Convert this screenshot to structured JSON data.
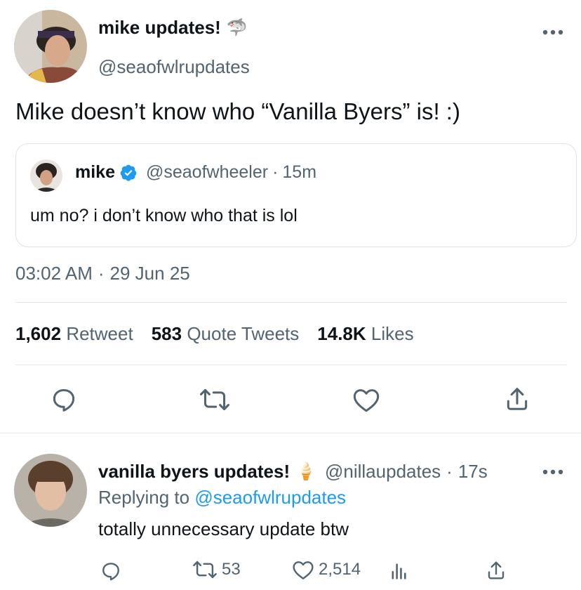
{
  "main_tweet": {
    "author_name": "mike updates!",
    "author_emoji": "🦈",
    "author_handle": "@seaofwlrupdates",
    "text": "Mike doesn’t know who “Vanilla Byers” is! :)",
    "more_icon": "more-horizontal-icon",
    "quoted": {
      "author_name": "mike",
      "verified_icon": "verified-badge-icon",
      "author_handle": "@seaofwheeler",
      "separator": "·",
      "time": "15m",
      "text": "um no? i don’t know who that is lol"
    },
    "time": "03:02 AM",
    "date_separator": "·",
    "date": "29 Jun 25",
    "stats": {
      "retweets_count": "1,602",
      "retweets_label": "Retweet",
      "quotes_count": "583",
      "quotes_label": "Quote Tweets",
      "likes_count": "14.8K",
      "likes_label": "Likes"
    },
    "actions": [
      "reply-icon",
      "retweet-icon",
      "like-icon",
      "share-icon"
    ]
  },
  "reply_tweet": {
    "author_name": "vanilla byers updates!",
    "author_emoji": "🍦",
    "author_handle": "@nillaupdates",
    "separator": "·",
    "time": "17s",
    "replying_prefix": "Replying to",
    "replying_to": "@seaofwlrupdates",
    "text": "totally unnecessary update btw",
    "retweet_count": "53",
    "like_count": "2,514",
    "actions": [
      "reply-icon",
      "retweet-icon",
      "like-icon",
      "analytics-icon",
      "share-icon"
    ]
  },
  "colors": {
    "text": "#0f1419",
    "secondary": "#536471",
    "accent": "#1d9bf0",
    "divider": "#e6e9ea"
  }
}
